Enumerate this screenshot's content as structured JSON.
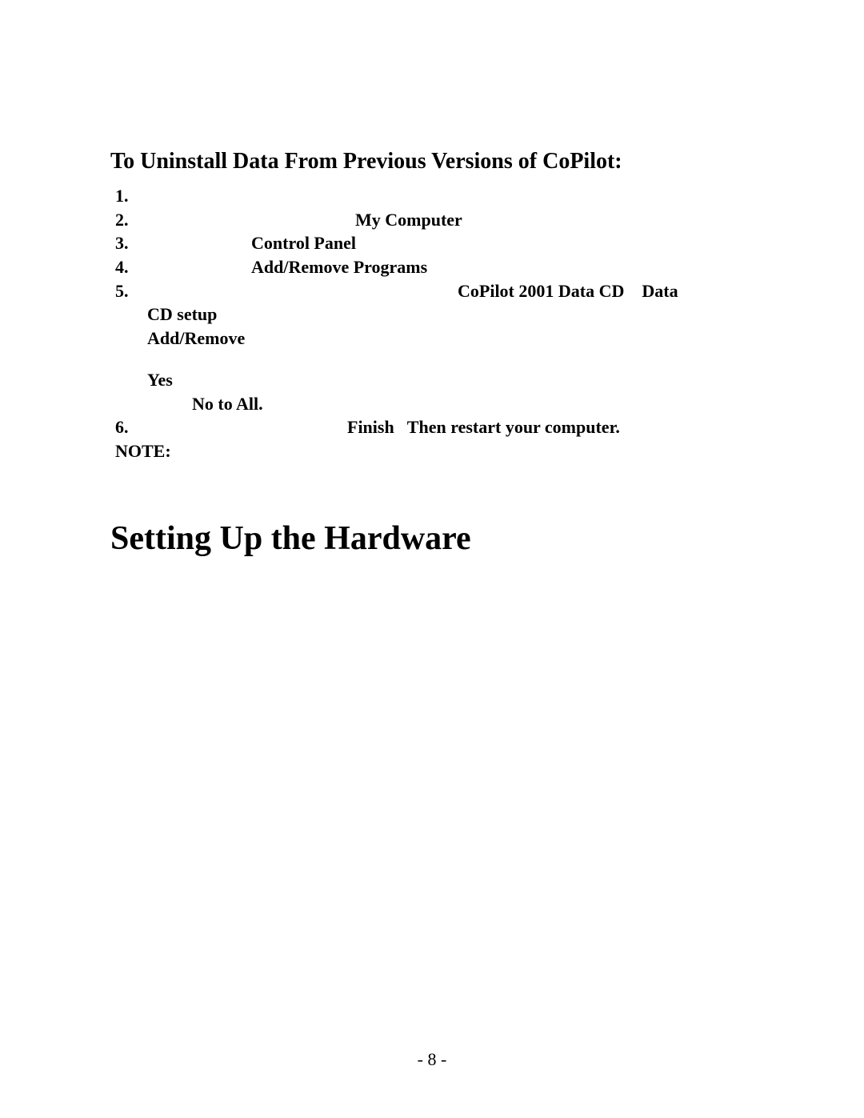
{
  "subheading": "To Uninstall Data From Previous Versions of CoPilot:",
  "items": {
    "n1": "1.",
    "n2": "2.",
    "n3": "3.",
    "n4": "4.",
    "n5": "5.",
    "n6": "6.",
    "b2": "My Computer",
    "b3": "Control Panel",
    "b4": "Add/Remove Programs",
    "b5a": "CoPilot 2001 Data CD    Data",
    "b5b": "CD setup",
    "b5c": "Add/Remove",
    "b5d": "Yes",
    "b5e": "No to All.",
    "b6": "Finish   Then restart your computer.",
    "note": "NOTE:"
  },
  "mainHeading": "Setting Up the Hardware",
  "pageNumber": "- 8 -"
}
